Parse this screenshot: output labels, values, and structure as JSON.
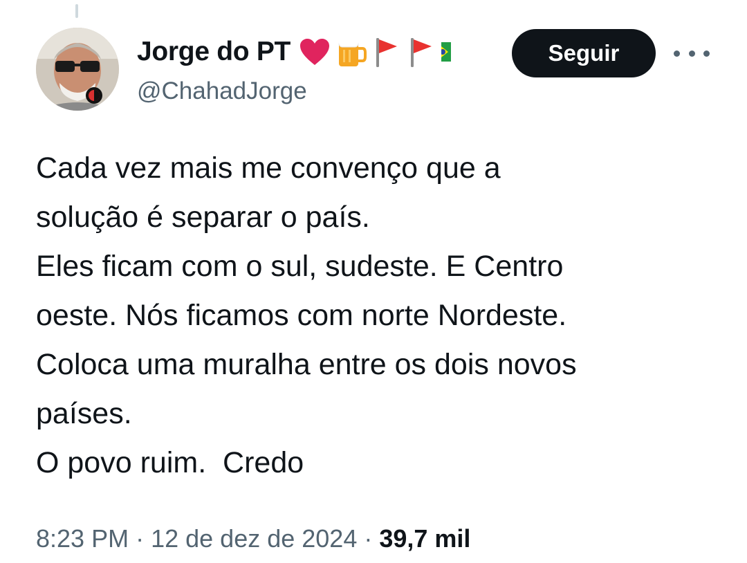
{
  "tweet": {
    "author": {
      "display_name": "Jorge do PT",
      "handle": "@ChahadJorge",
      "name_emojis": [
        "heart-emoji",
        "beer-emoji",
        "red-flag-emoji",
        "red-flag-emoji",
        "brazil-flag-emoji"
      ]
    },
    "follow_label": "Seguir",
    "more_label": "More options",
    "text": "Cada vez mais me convenço que a\nsolução é separar o país.\nEles ficam com o sul, sudeste. E Centro\noeste. Nós ficamos com norte Nordeste.\nColoca uma muralha entre os dois novos\npaíses.\nO povo ruim.  Credo",
    "time": "8:23 PM",
    "date": "12 de dez de 2024",
    "separator": "·",
    "views": "39,7 mil"
  },
  "colors": {
    "text_primary": "#0f1419",
    "text_secondary": "#536471",
    "button_bg": "#0f1419",
    "button_text": "#ffffff",
    "heart": "#e0245e",
    "flag_red": "#e8322f"
  }
}
